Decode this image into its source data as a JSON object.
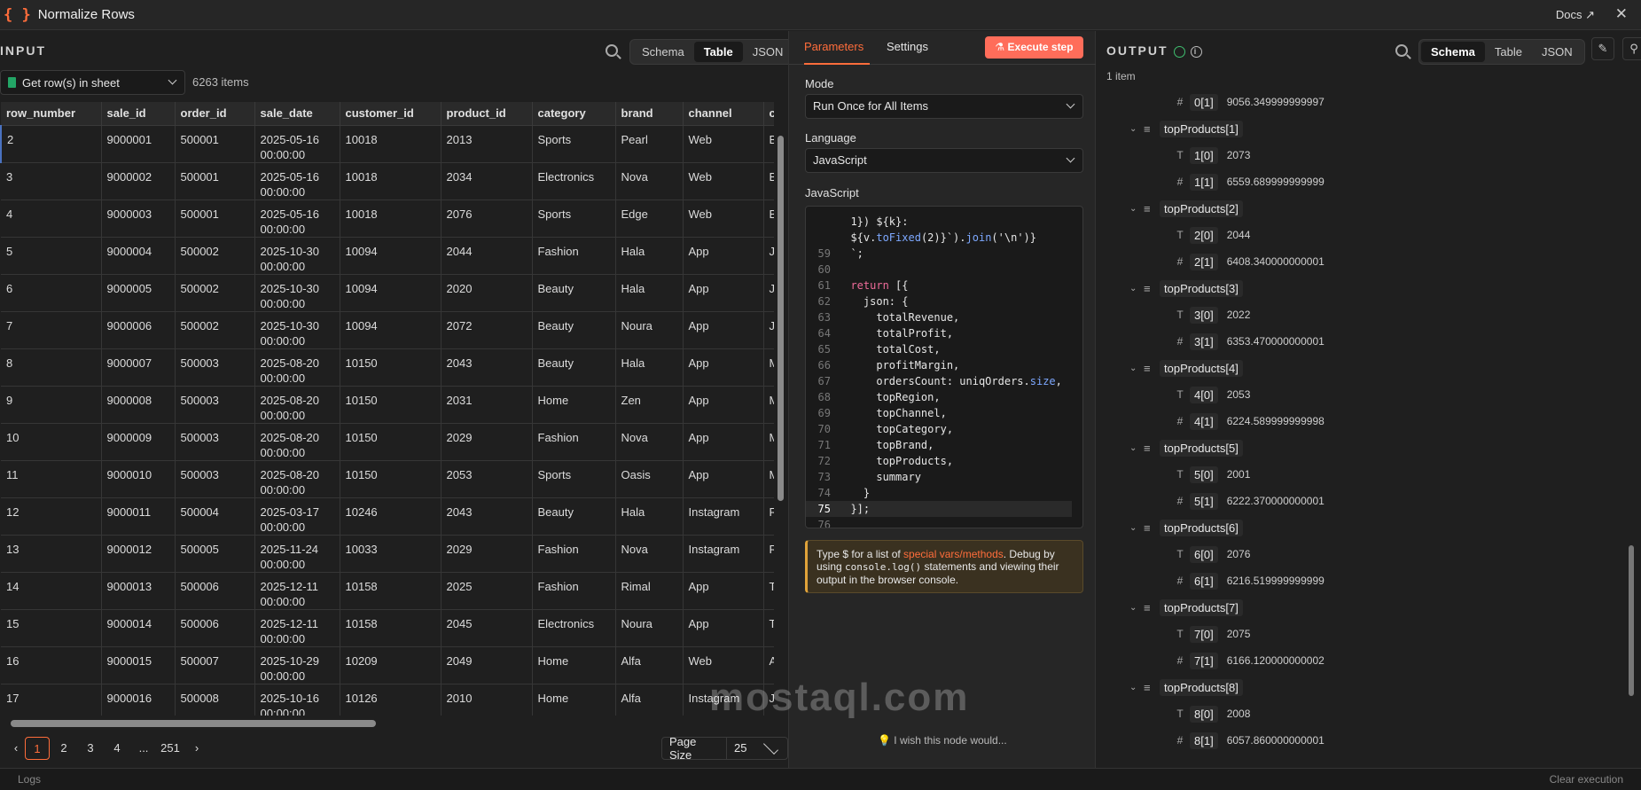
{
  "header": {
    "title": "Normalize Rows",
    "docs": "Docs"
  },
  "input": {
    "label": "INPUT",
    "tabs": [
      "Schema",
      "Table",
      "JSON"
    ],
    "active_tab": "Table",
    "node_select": "Get row(s) in sheet",
    "items_count": "6263 items",
    "columns": [
      "row_number",
      "sale_id",
      "order_id",
      "sale_date",
      "customer_id",
      "product_id",
      "category",
      "brand",
      "channel",
      "ci"
    ],
    "rows": [
      [
        "2",
        "9000001",
        "500001",
        "2025-05-16",
        "00:00:00",
        "10018",
        "2013",
        "Sports",
        "Pearl",
        "Web",
        "Bu"
      ],
      [
        "3",
        "9000002",
        "500001",
        "2025-05-16",
        "00:00:00",
        "10018",
        "2034",
        "Electronics",
        "Nova",
        "Web",
        "Bu"
      ],
      [
        "4",
        "9000003",
        "500001",
        "2025-05-16",
        "00:00:00",
        "10018",
        "2076",
        "Sports",
        "Edge",
        "Web",
        "Bu"
      ],
      [
        "5",
        "9000004",
        "500002",
        "2025-10-30",
        "00:00:00",
        "10094",
        "2044",
        "Fashion",
        "Hala",
        "App",
        "Je"
      ],
      [
        "6",
        "9000005",
        "500002",
        "2025-10-30",
        "00:00:00",
        "10094",
        "2020",
        "Beauty",
        "Hala",
        "App",
        "Je"
      ],
      [
        "7",
        "9000006",
        "500002",
        "2025-10-30",
        "00:00:00",
        "10094",
        "2072",
        "Beauty",
        "Noura",
        "App",
        "Je"
      ],
      [
        "8",
        "9000007",
        "500003",
        "2025-08-20",
        "00:00:00",
        "10150",
        "2043",
        "Beauty",
        "Hala",
        "App",
        "Ma"
      ],
      [
        "9",
        "9000008",
        "500003",
        "2025-08-20",
        "00:00:00",
        "10150",
        "2031",
        "Home",
        "Zen",
        "App",
        "Ma"
      ],
      [
        "10",
        "9000009",
        "500003",
        "2025-08-20",
        "00:00:00",
        "10150",
        "2029",
        "Fashion",
        "Nova",
        "App",
        "Ma"
      ],
      [
        "11",
        "9000010",
        "500003",
        "2025-08-20",
        "00:00:00",
        "10150",
        "2053",
        "Sports",
        "Oasis",
        "App",
        "Ma"
      ],
      [
        "12",
        "9000011",
        "500004",
        "2025-03-17",
        "00:00:00",
        "10246",
        "2043",
        "Beauty",
        "Hala",
        "Instagram",
        "Ri"
      ],
      [
        "13",
        "9000012",
        "500005",
        "2025-11-24",
        "00:00:00",
        "10033",
        "2029",
        "Fashion",
        "Nova",
        "Instagram",
        "Ri"
      ],
      [
        "14",
        "9000013",
        "500006",
        "2025-12-11",
        "00:00:00",
        "10158",
        "2025",
        "Fashion",
        "Rimal",
        "App",
        "Ta"
      ],
      [
        "15",
        "9000014",
        "500006",
        "2025-12-11",
        "00:00:00",
        "10158",
        "2045",
        "Electronics",
        "Noura",
        "App",
        "Ta"
      ],
      [
        "16",
        "9000015",
        "500007",
        "2025-10-29",
        "00:00:00",
        "10209",
        "2049",
        "Home",
        "Alfa",
        "Web",
        "Ab"
      ],
      [
        "17",
        "9000016",
        "500008",
        "2025-10-16",
        "00:00:00",
        "10126",
        "2010",
        "Home",
        "Alfa",
        "Instagram",
        "Je"
      ]
    ],
    "pagination": {
      "pages": [
        "1",
        "2",
        "3",
        "4",
        "...",
        "251"
      ],
      "active": "1",
      "page_size_label": "Page Size",
      "page_size": "25"
    }
  },
  "params": {
    "tabs": [
      "Parameters",
      "Settings"
    ],
    "execute": "Execute step",
    "mode_label": "Mode",
    "mode_value": "Run Once for All Items",
    "language_label": "Language",
    "language_value": "JavaScript",
    "code_label": "JavaScript",
    "code_lines": [
      {
        "n": "",
        "t": "  1}) ${k}:"
      },
      {
        "n": "",
        "t": "  ${v.toFixed(2)}`).join('\\n')}"
      },
      {
        "n": "59",
        "t": "  `;"
      },
      {
        "n": "60",
        "t": ""
      },
      {
        "n": "61",
        "t": "  return [{"
      },
      {
        "n": "62",
        "t": "    json: {"
      },
      {
        "n": "63",
        "t": "      totalRevenue,"
      },
      {
        "n": "64",
        "t": "      totalProfit,"
      },
      {
        "n": "65",
        "t": "      totalCost,"
      },
      {
        "n": "66",
        "t": "      profitMargin,"
      },
      {
        "n": "67",
        "t": "      ordersCount: uniqOrders.size,"
      },
      {
        "n": "68",
        "t": "      topRegion,"
      },
      {
        "n": "69",
        "t": "      topChannel,"
      },
      {
        "n": "70",
        "t": "      topCategory,"
      },
      {
        "n": "71",
        "t": "      topBrand,"
      },
      {
        "n": "72",
        "t": "      topProducts,"
      },
      {
        "n": "73",
        "t": "      summary"
      },
      {
        "n": "74",
        "t": "    }"
      },
      {
        "n": "75",
        "t": "  }];"
      },
      {
        "n": "76",
        "t": ""
      }
    ],
    "hint": {
      "pre": "Type $ for a list of ",
      "link": "special vars/methods",
      "post": ". Debug by using ",
      "code": "console.log()",
      "post2": " statements and viewing their output in the browser console."
    },
    "wish": "I wish this node would..."
  },
  "output": {
    "label": "OUTPUT",
    "tabs": [
      "Schema",
      "Table",
      "JSON"
    ],
    "active_tab": "Schema",
    "items": "1 item",
    "tree": [
      {
        "k": "0[1]",
        "v": "9056.349999999997",
        "t": "#",
        "lvl": 2
      },
      {
        "k": "topProducts[1]",
        "t": "list",
        "lvl": 1
      },
      {
        "k": "1[0]",
        "v": "2073",
        "t": "T",
        "lvl": 2
      },
      {
        "k": "1[1]",
        "v": "6559.689999999999",
        "t": "#",
        "lvl": 2
      },
      {
        "k": "topProducts[2]",
        "t": "list",
        "lvl": 1
      },
      {
        "k": "2[0]",
        "v": "2044",
        "t": "T",
        "lvl": 2
      },
      {
        "k": "2[1]",
        "v": "6408.340000000001",
        "t": "#",
        "lvl": 2
      },
      {
        "k": "topProducts[3]",
        "t": "list",
        "lvl": 1
      },
      {
        "k": "3[0]",
        "v": "2022",
        "t": "T",
        "lvl": 2
      },
      {
        "k": "3[1]",
        "v": "6353.470000000001",
        "t": "#",
        "lvl": 2
      },
      {
        "k": "topProducts[4]",
        "t": "list",
        "lvl": 1
      },
      {
        "k": "4[0]",
        "v": "2053",
        "t": "T",
        "lvl": 2
      },
      {
        "k": "4[1]",
        "v": "6224.589999999998",
        "t": "#",
        "lvl": 2
      },
      {
        "k": "topProducts[5]",
        "t": "list",
        "lvl": 1
      },
      {
        "k": "5[0]",
        "v": "2001",
        "t": "T",
        "lvl": 2
      },
      {
        "k": "5[1]",
        "v": "6222.370000000001",
        "t": "#",
        "lvl": 2
      },
      {
        "k": "topProducts[6]",
        "t": "list",
        "lvl": 1
      },
      {
        "k": "6[0]",
        "v": "2076",
        "t": "T",
        "lvl": 2
      },
      {
        "k": "6[1]",
        "v": "6216.519999999999",
        "t": "#",
        "lvl": 2
      },
      {
        "k": "topProducts[7]",
        "t": "list",
        "lvl": 1
      },
      {
        "k": "7[0]",
        "v": "2075",
        "t": "T",
        "lvl": 2
      },
      {
        "k": "7[1]",
        "v": "6166.120000000002",
        "t": "#",
        "lvl": 2
      },
      {
        "k": "topProducts[8]",
        "t": "list",
        "lvl": 1
      },
      {
        "k": "8[0]",
        "v": "2008",
        "t": "T",
        "lvl": 2
      },
      {
        "k": "8[1]",
        "v": "6057.860000000001",
        "t": "#",
        "lvl": 2
      }
    ]
  },
  "footer": {
    "logs": "Logs",
    "clear": "Clear execution"
  },
  "watermark": "mostaql.com",
  "colors": {
    "accent": "#ff6d3b",
    "execute": "#ff6d5a",
    "success": "#3fbf6f"
  }
}
